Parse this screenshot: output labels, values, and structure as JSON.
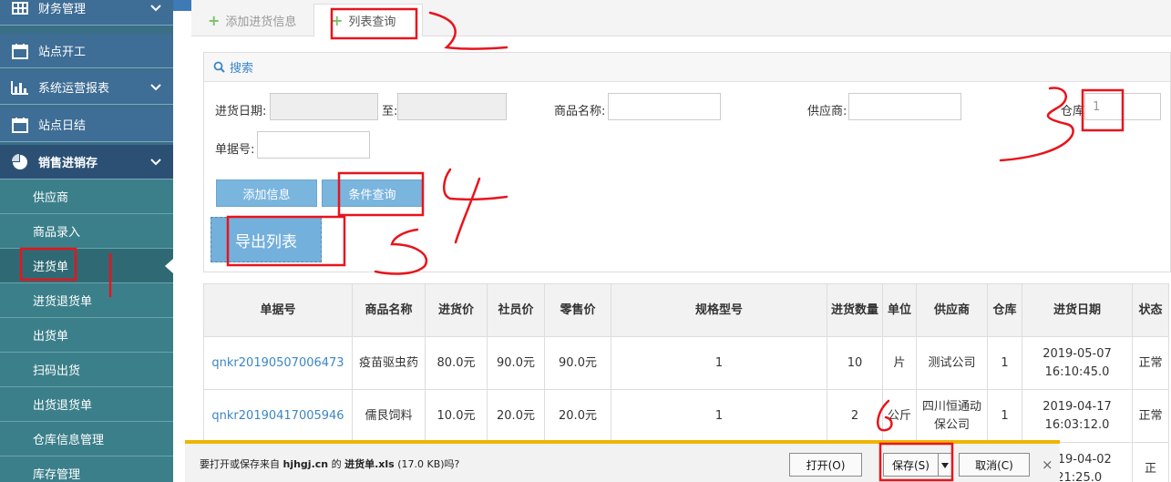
{
  "sidebar": {
    "items": [
      {
        "label": "财务管理",
        "icon": "grid-icon",
        "expandable": true
      },
      {
        "label": "站点开工",
        "icon": "calendar-icon",
        "expandable": false
      },
      {
        "label": "系统运营报表",
        "icon": "bar-chart-icon",
        "expandable": true
      },
      {
        "label": "站点日结",
        "icon": "calendar-icon",
        "expandable": false
      },
      {
        "label": "销售进销存",
        "icon": "pie-chart-icon",
        "expandable": true,
        "active": true
      }
    ],
    "sub_items": [
      {
        "label": "供应商"
      },
      {
        "label": "商品录入"
      },
      {
        "label": "进货单",
        "active": true
      },
      {
        "label": "进货退货单"
      },
      {
        "label": "出货单"
      },
      {
        "label": "扫码出货"
      },
      {
        "label": "出货退货单"
      },
      {
        "label": "仓库信息管理"
      },
      {
        "label": "库存管理"
      }
    ]
  },
  "tabs": [
    {
      "label": "添加进货信息",
      "active": false
    },
    {
      "label": "列表查询",
      "active": true
    }
  ],
  "search": {
    "title": "搜索",
    "date_label": "进货日期:",
    "date_from": "",
    "to_label": "至:",
    "date_to": "",
    "product_label": "商品名称:",
    "product_value": "",
    "supplier_label": "供应商:",
    "supplier_value": "",
    "warehouse_label": "仓库:",
    "warehouse_value": "1",
    "doc_label": "单据号:",
    "doc_value": ""
  },
  "buttons": {
    "add": "添加信息",
    "query": "条件查询",
    "export": "导出列表"
  },
  "table": {
    "columns": [
      "单据号",
      "商品名称",
      "进货价",
      "社员价",
      "零售价",
      "规格型号",
      "进货数量",
      "单位",
      "供应商",
      "仓库",
      "进货日期",
      "状态"
    ],
    "rows": [
      {
        "doc": "qnkr20190507006473",
        "name": "疫苗驱虫药",
        "price": "80.0元",
        "member": "90.0元",
        "retail": "90.0元",
        "spec": "1",
        "qty": "10",
        "unit": "片",
        "supplier": "测试公司",
        "wh": "1",
        "date": "2019-05-07 16:10:45.0",
        "status": "正常"
      },
      {
        "doc": "qnkr20190417005946",
        "name": "儒艮饲料",
        "price": "10.0元",
        "member": "20.0元",
        "retail": "20.0元",
        "spec": "1",
        "qty": "2",
        "unit": "公斤",
        "supplier": "四川恒通动保公司",
        "wh": "1",
        "date": "2019-04-17 16:03:12.0",
        "status": "正常"
      },
      {
        "doc": "",
        "name": "",
        "price": "",
        "member": "",
        "retail": "",
        "spec": "",
        "qty": "",
        "unit": "",
        "supplier": "",
        "wh": "",
        "date": "2019-04-02 :21:25.0",
        "status": "正"
      }
    ]
  },
  "download": {
    "prefix": "要打开或保存来自",
    "site": "hjhgj.cn",
    "mid": "的",
    "file": "进货单.xls",
    "size": "(17.0 KB)吗?",
    "open": "打开(O)",
    "save": "保存(S)",
    "cancel": "取消(C)"
  },
  "annotations": [
    "2",
    "3",
    "4",
    "5",
    "6"
  ],
  "colors": {
    "annotation": "#e8141c",
    "accent": "#3b86c6",
    "sidebar_sub": "#3b7f8a",
    "sidebar_top": "#3e6d95",
    "download_border": "#f0b400"
  }
}
